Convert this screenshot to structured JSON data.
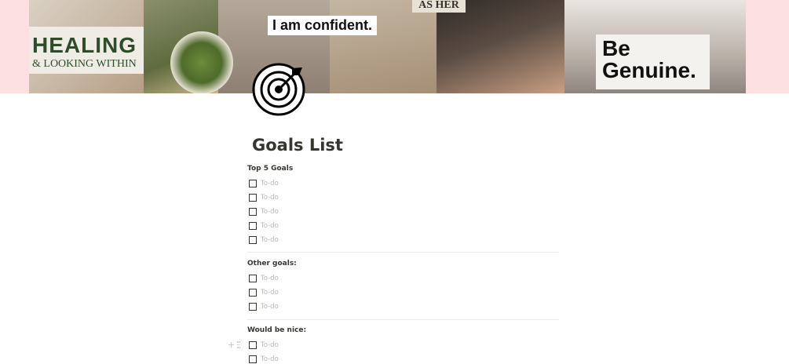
{
  "cover": {
    "healing_title": "HEALING",
    "healing_subtitle": "& LOOKING WITHIN",
    "confident": "I am confident.",
    "asher": "AS HER",
    "genuine_line1": "Be",
    "genuine_line2": "Genuine."
  },
  "page": {
    "icon": "target-icon",
    "title": "Goals List"
  },
  "sections": {
    "top5": {
      "heading": "Top 5 Goals",
      "todos": [
        "To-do",
        "To-do",
        "To-do",
        "To-do",
        "To-do"
      ]
    },
    "other": {
      "heading": "Other goals:",
      "todos": [
        "To-do",
        "To-do",
        "To-do"
      ]
    },
    "nice": {
      "heading": "Would be nice:",
      "todos": [
        "To-do",
        "To-do"
      ]
    }
  },
  "block_handle": {
    "add_icon": "plus-icon",
    "drag_icon": "drag-handle-icon",
    "add_glyph": "+"
  },
  "colors": {
    "cover_background": "#fde0e2",
    "text": "#37352f",
    "placeholder": "#b9b8b4",
    "divider": "#ebebea"
  }
}
